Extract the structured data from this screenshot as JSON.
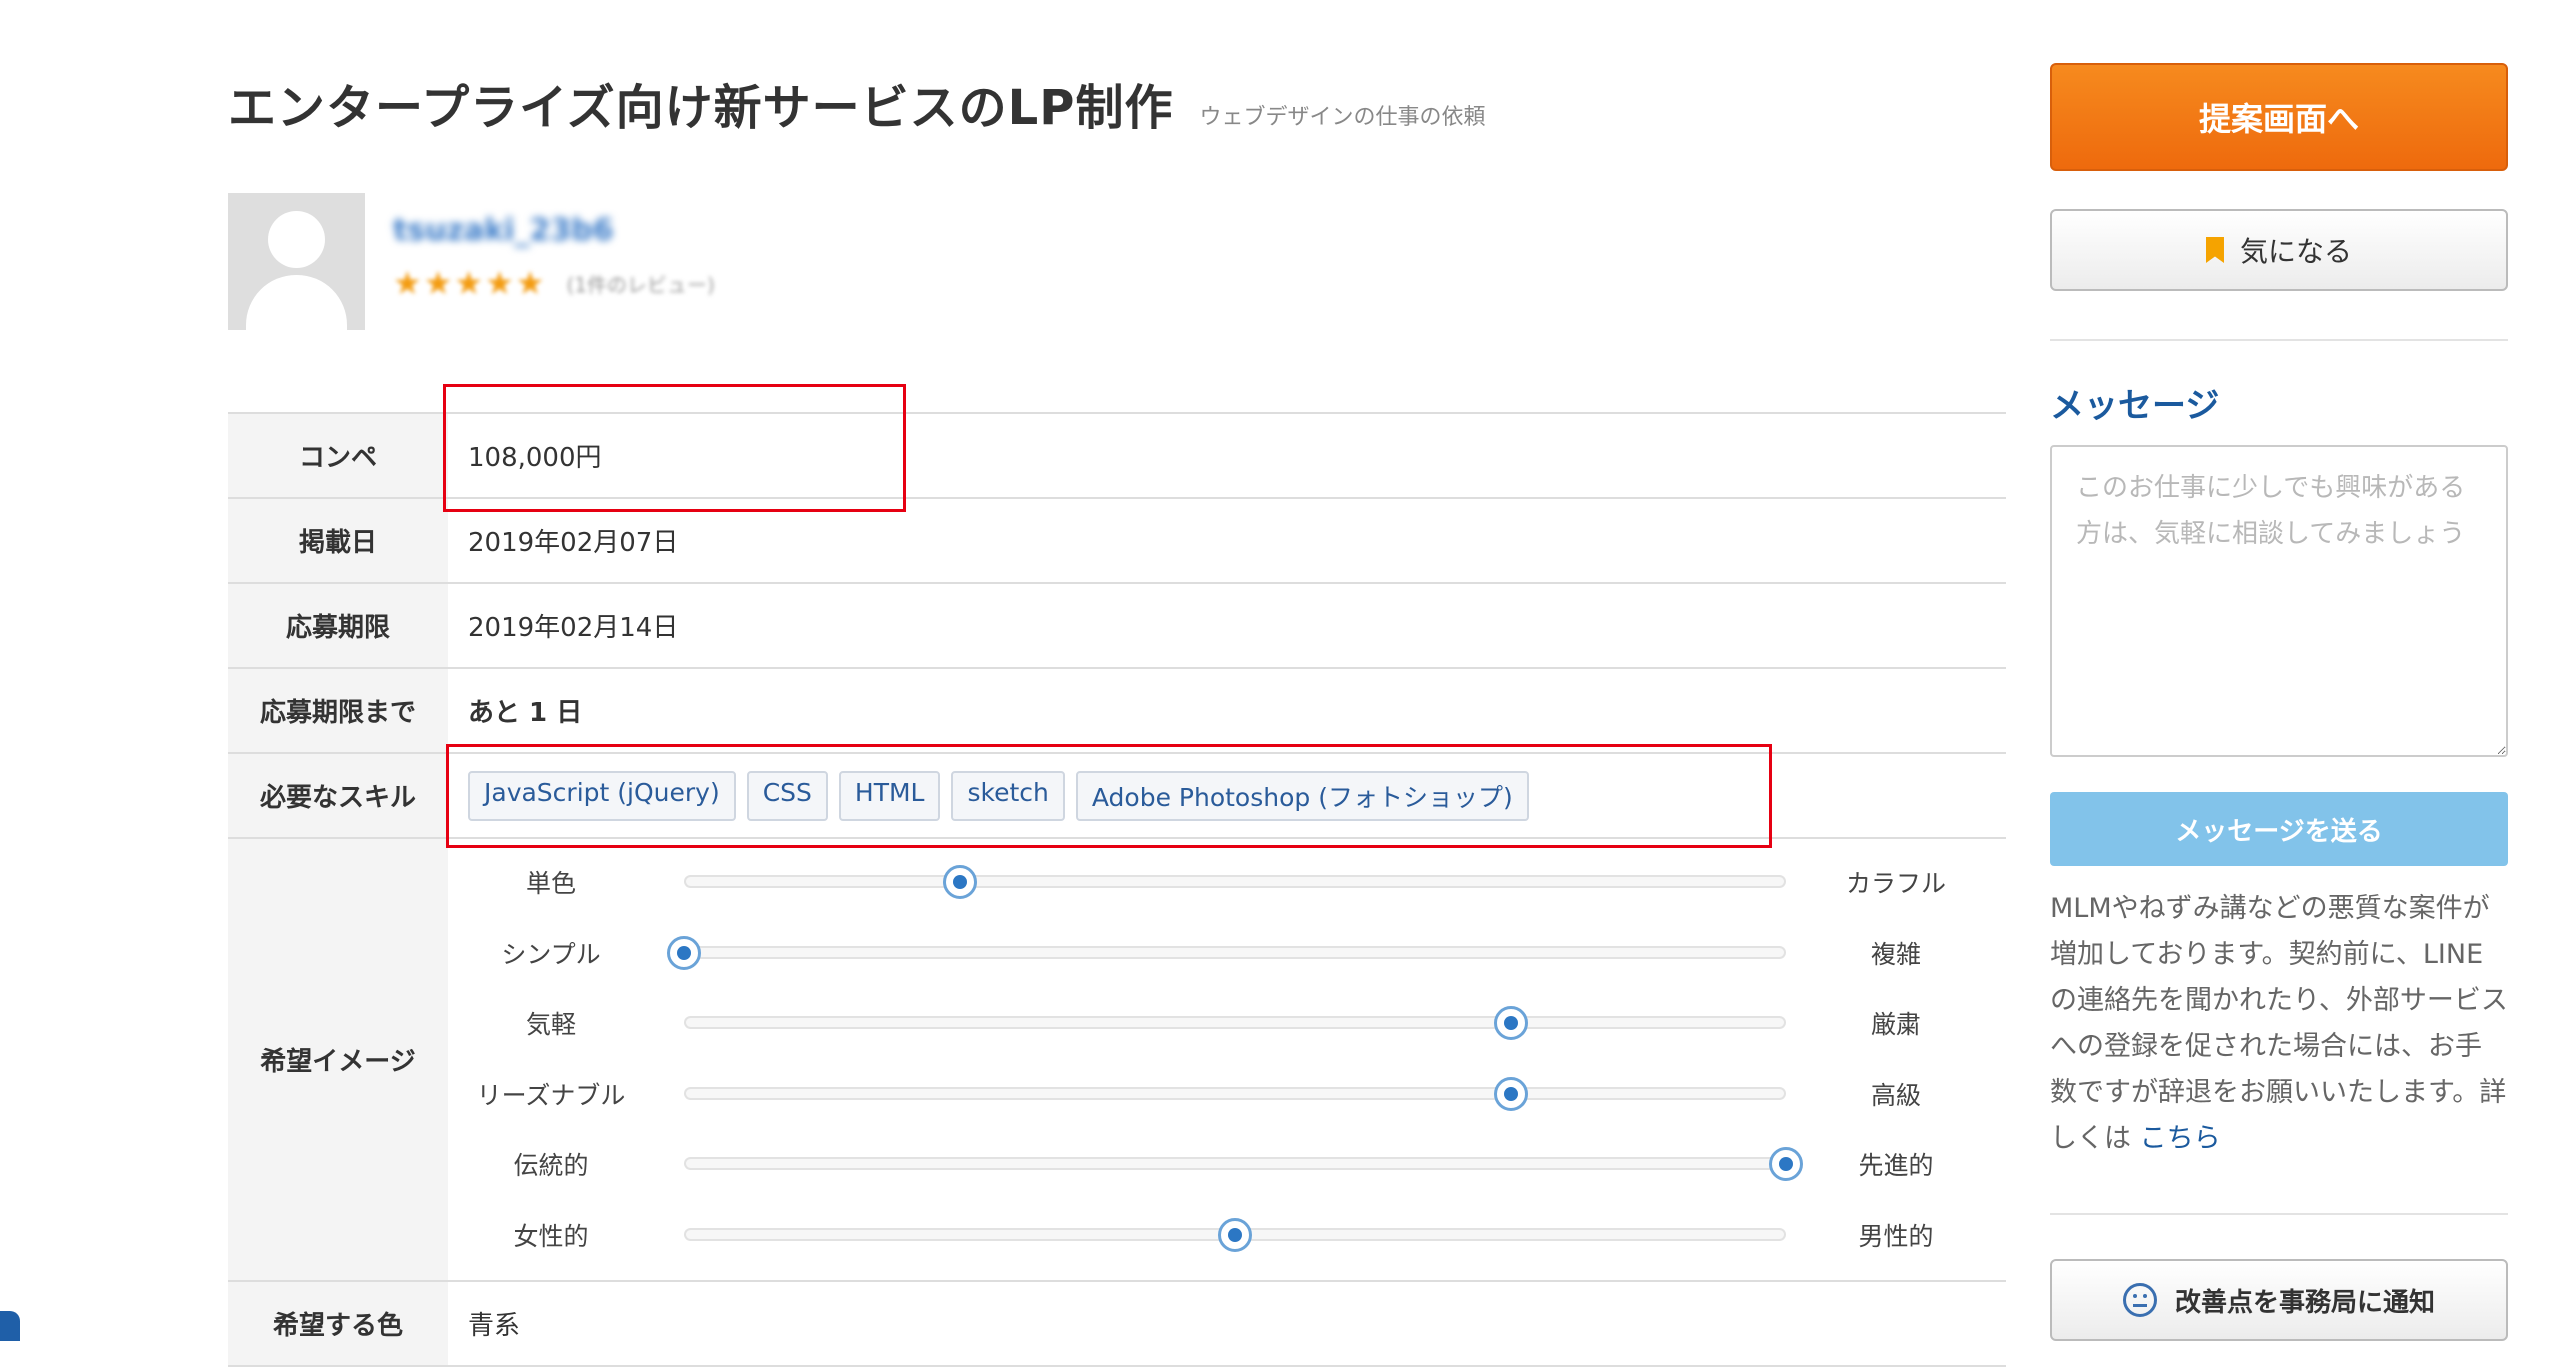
{
  "title": "エンタープライズ向け新サービスのLP制作",
  "category": "ウェブデザインの仕事の依頼",
  "client": {
    "username": "tsuzaki_23b6",
    "stars": "★★★★★",
    "review_count": "(1件のレビュー)",
    "rating": 5
  },
  "details": {
    "type_label": "コンペ",
    "type_value": "108,000円",
    "posted_label": "掲載日",
    "posted_value": "2019年02月07日",
    "deadline_label": "応募期限",
    "deadline_value": "2019年02月14日",
    "remaining_label": "応募期限まで",
    "remaining_value": "あと 1 日",
    "skills_label": "必要なスキル",
    "skills": [
      "JavaScript (jQuery)",
      "CSS",
      "HTML",
      "sketch",
      "Adobe Photoshop (フォトショップ)"
    ],
    "image_label": "希望イメージ",
    "sliders": [
      {
        "left": "単色",
        "right": "カラフル",
        "value": 0.25
      },
      {
        "left": "シンプル",
        "right": "複雑",
        "value": 0.0
      },
      {
        "left": "気軽",
        "right": "厳粛",
        "value": 0.75
      },
      {
        "left": "リーズナブル",
        "right": "高級",
        "value": 0.75
      },
      {
        "left": "伝統的",
        "right": "先進的",
        "value": 1.0
      },
      {
        "left": "女性的",
        "right": "男性的",
        "value": 0.5
      }
    ],
    "color_label": "希望する色",
    "color_value": "青系"
  },
  "sidebar": {
    "propose_label": "提案画面へ",
    "favorite_label": "気になる",
    "message_title": "メッセージ",
    "message_placeholder": "このお仕事に少しでも興味がある方は、気軽に相談してみましょう",
    "send_label": "メッセージを送る",
    "warning_text": "MLMやねずみ講などの悪質な案件が増加しております。契約前に、LINEの連絡先を聞かれたり、外部サービスへの登録を促された場合には、お手数ですが辞退をお願いいたします。詳しくは",
    "warning_link": "こちら",
    "report_label": "改善点を事務局に通知"
  },
  "colors": {
    "accent_orange": "#f07b16",
    "link_blue": "#1b5a9e",
    "send_button": "#82c3ea",
    "annotation_red": "#e60012"
  }
}
